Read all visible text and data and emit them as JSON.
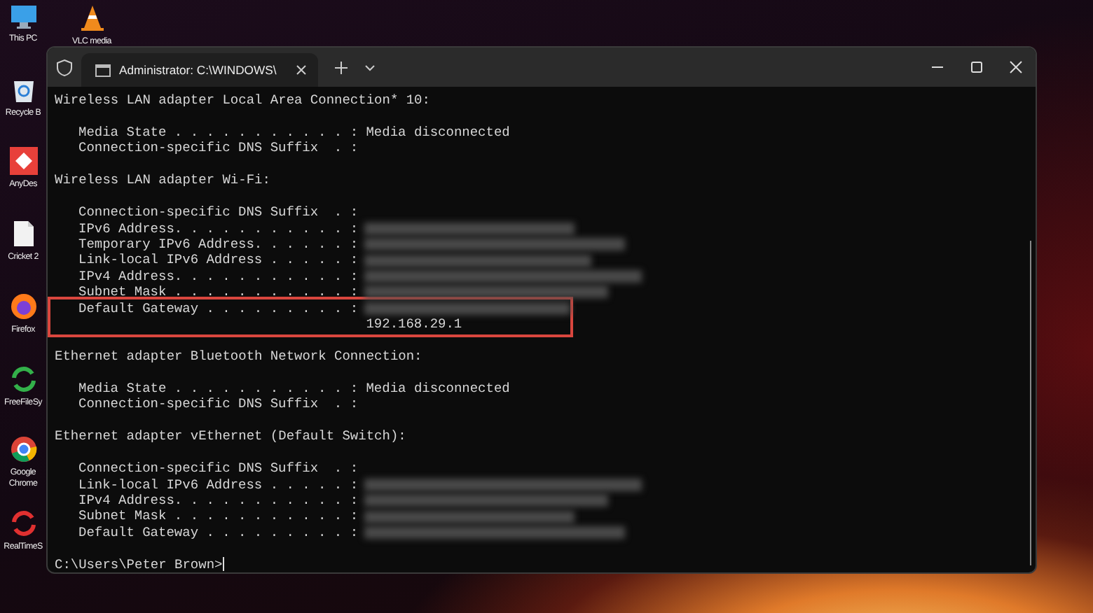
{
  "desktop_icons": [
    {
      "label": "This PC",
      "kind": "monitor"
    },
    {
      "label": "VLC media",
      "kind": "cone"
    },
    {
      "label": "Recycle B",
      "kind": "bin"
    },
    {
      "label": "AnyDes",
      "kind": "remote"
    },
    {
      "label": "Cricket 2",
      "kind": "file"
    },
    {
      "label": "Firefox",
      "kind": "firefox"
    },
    {
      "label": "FreeFileSy",
      "kind": "sync"
    },
    {
      "label": "Google Chrome",
      "kind": "chrome"
    },
    {
      "label": "RealTimeS",
      "kind": "sync-red"
    }
  ],
  "window": {
    "tab": {
      "title": "Administrator: C:\\WINDOWS\\",
      "selected": true
    },
    "sections": [
      {
        "heading": "Wireless LAN adapter Local Area Connection* 10:",
        "entries": [
          {
            "label": "Media State . . . . . . . . . . . :",
            "value": "Media disconnected",
            "redacted": false,
            "highlighted": false
          },
          {
            "label": "Connection-specific DNS Suffix  . :",
            "redacted": false,
            "highlighted": false
          }
        ]
      },
      {
        "heading": "Wireless LAN adapter Wi-Fi:",
        "entries": [
          {
            "label": "Connection-specific DNS Suffix  . :",
            "redacted": false,
            "highlighted": false
          },
          {
            "label": "IPv6 Address. . . . . . . . . . . :",
            "redacted": true,
            "highlighted": false
          },
          {
            "label": "Temporary IPv6 Address. . . . . . :",
            "redacted": true,
            "highlighted": false
          },
          {
            "label": "Link-local IPv6 Address . . . . . :",
            "redacted": true,
            "highlighted": false
          },
          {
            "label": "IPv4 Address. . . . . . . . . . . :",
            "redacted": true,
            "highlighted": false
          },
          {
            "label": "Subnet Mask . . . . . . . . . . . :",
            "redacted": true,
            "highlighted": false
          },
          {
            "label": "Default Gateway . . . . . . . . . :",
            "redacted": true,
            "continuation": "192.168.29.1",
            "highlighted": true
          }
        ]
      },
      {
        "heading": "Ethernet adapter Bluetooth Network Connection:",
        "entries": [
          {
            "label": "Media State . . . . . . . . . . . :",
            "value": "Media disconnected",
            "redacted": false,
            "highlighted": false
          },
          {
            "label": "Connection-specific DNS Suffix  . :",
            "redacted": false,
            "highlighted": false
          }
        ]
      },
      {
        "heading": "Ethernet adapter vEthernet (Default Switch):",
        "entries": [
          {
            "label": "Connection-specific DNS Suffix  . :",
            "redacted": false,
            "highlighted": false
          },
          {
            "label": "Link-local IPv6 Address . . . . . :",
            "redacted": true,
            "highlighted": false
          },
          {
            "label": "IPv4 Address. . . . . . . . . . . :",
            "redacted": true,
            "highlighted": false
          },
          {
            "label": "Subnet Mask . . . . . . . . . . . :",
            "redacted": true,
            "highlighted": false
          },
          {
            "label": "Default Gateway . . . . . . . . . :",
            "redacted": true,
            "highlighted": false
          }
        ]
      }
    ],
    "prompt": "C:\\Users\\Peter Brown>"
  }
}
